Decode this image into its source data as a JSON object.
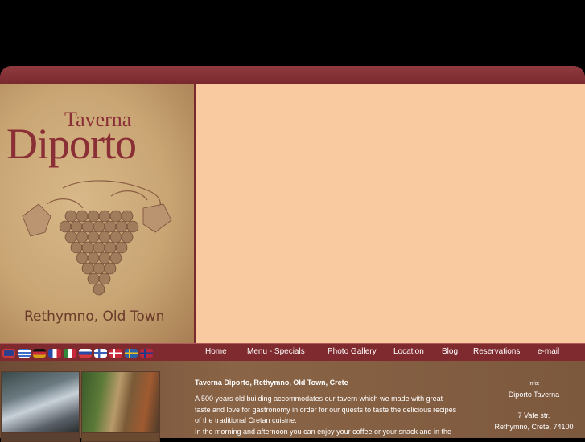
{
  "logo": {
    "line1": "Taverna",
    "line2": "Diporto",
    "location": "Rethymno, Old Town"
  },
  "flags": [
    {
      "name": "english-flag-icon",
      "color": "#2a3f8f"
    },
    {
      "name": "greek-flag-icon",
      "color": "#3d6cc4"
    },
    {
      "name": "german-flag-icon",
      "color": "#d4a017"
    },
    {
      "name": "french-flag-icon",
      "color": "#2848a8"
    },
    {
      "name": "italian-flag-icon",
      "color": "#2f8a3a"
    },
    {
      "name": "russian-flag-icon",
      "color": "#d83a3a"
    },
    {
      "name": "finnish-flag-icon",
      "color": "#3b5fb8"
    },
    {
      "name": "danish-flag-icon",
      "color": "#c8283a"
    },
    {
      "name": "swedish-flag-icon",
      "color": "#2a62a8"
    },
    {
      "name": "norwegian-flag-icon",
      "color": "#b8283a"
    }
  ],
  "nav": {
    "home": "Home",
    "menu": "Menu - Specials",
    "gallery": "Photo Gallery",
    "location": "Location",
    "blog": "Blog",
    "reservations": "Reservations",
    "email": "e-mail"
  },
  "intro": {
    "title": "Taverna Diporto, Rethymno, Old Town, Crete",
    "lines": [
      "A 500 years old building accommodates our tavern which we made with great",
      "taste and love for gastronomy in order for our quests to taste the delicious recipes",
      "of the traditional Cretan cuisine.",
      "In the morning and afternoon you can enjoy your coffee or your snack and in the"
    ]
  },
  "info": {
    "label": "Info:",
    "name": "Diporto Taverna",
    "street": "7 Vafe str.",
    "city": "Rethymno, Crete, 74100"
  },
  "colors": {
    "brand": "#8a2f35",
    "hero": "#f9c9a0",
    "nav": "#7f2a2e"
  }
}
